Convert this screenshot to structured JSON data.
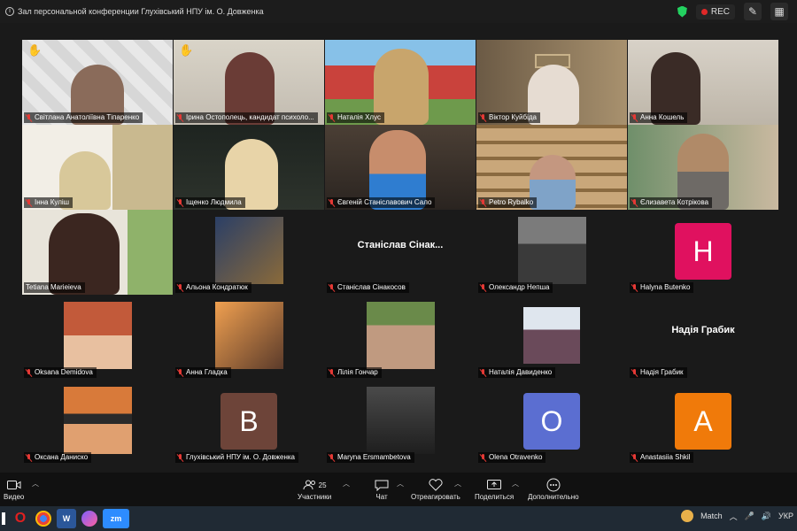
{
  "window": {
    "title": "Зал персональной конференции Глухівський НПУ ім. О. Довженка"
  },
  "recording": {
    "label": "REC"
  },
  "participants": [
    {
      "name": "Світлана Анатоліївна Тіпаренко",
      "hand": true
    },
    {
      "name": "Ірина Остополець, кандидат психоло...",
      "hand": true
    },
    {
      "name": "Наталія Хлус"
    },
    {
      "name": "Віктор Куйбіда"
    },
    {
      "name": "Анна Кошель"
    },
    {
      "name": "Інна Куліш"
    },
    {
      "name": "Іщенко Людмила"
    },
    {
      "name": "Євгеній Станіславович Сало"
    },
    {
      "name": "Petro Rybalko"
    },
    {
      "name": "Єлизавета Котрікова"
    },
    {
      "name": "Tetiana Marieieva",
      "active": true
    },
    {
      "name": "Альона Кондратюк"
    },
    {
      "name": "Станіслав Сінакосов",
      "display": "Станіслав Сінак..."
    },
    {
      "name": "Олександр Непша"
    },
    {
      "name": "Halyna Butenko",
      "letter": "H",
      "color": "#e0115f"
    },
    {
      "name": "Oksana Demidova"
    },
    {
      "name": "Анна Гладка"
    },
    {
      "name": "Лілія Гончар"
    },
    {
      "name": "Наталія Давиденко"
    },
    {
      "name": "Надія Грабик",
      "display": "Надія Грабик"
    },
    {
      "name": "Оксана Даниско"
    },
    {
      "name": "Глухівський НПУ ім. О. Довженка",
      "letter": "В",
      "color": "#6d4439"
    },
    {
      "name": "Maryna Ersmambetova"
    },
    {
      "name": "Olena Otravenko",
      "letter": "O",
      "color": "#5b6ed1"
    },
    {
      "name": "Anastasiia Shkil",
      "letter": "A",
      "color": "#f07a0a"
    }
  ],
  "toolbar": {
    "video": "Видео",
    "participants": "Участники",
    "participants_count": "25",
    "chat": "Чат",
    "react": "Отреагировать",
    "share": "Поделиться",
    "more": "Дополнительно"
  },
  "taskbar": {
    "match": "Match",
    "lang": "УКР",
    "zoom": "zm"
  },
  "colors": {
    "active": "#2ec27e",
    "muted": "#e53935",
    "shield": "#23d160",
    "rec": "#e02828"
  }
}
